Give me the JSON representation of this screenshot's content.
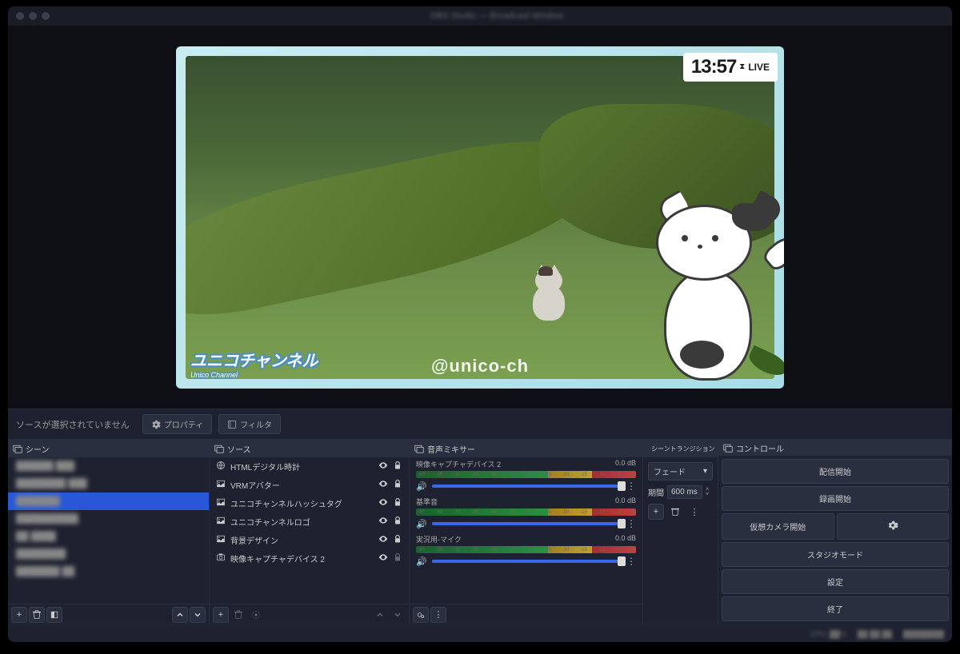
{
  "titlebar": {
    "title": "OBS Studio — Broadcast Window"
  },
  "preview": {
    "clock": "13:57",
    "live": "LIVE",
    "channel_name": "ユニコチャンネル",
    "channel_sub": "Unico Channel",
    "handle": "@unico-ch"
  },
  "toolbar": {
    "no_selection": "ソースが選択されていません",
    "properties": "プロパティ",
    "filters": "フィルタ"
  },
  "panels": {
    "scenes": {
      "title": "シーン"
    },
    "sources": {
      "title": "ソース"
    },
    "mixer": {
      "title": "音声ミキサー"
    },
    "transitions": {
      "title": "シーントランジション"
    },
    "controls": {
      "title": "コントロール"
    }
  },
  "scenes": [
    {
      "label": "██████   ███",
      "selected": false,
      "blur": true
    },
    {
      "label": "████████   ███",
      "selected": false,
      "blur": true
    },
    {
      "label": "███████",
      "selected": true,
      "blur": true
    },
    {
      "label": "██████████",
      "selected": false,
      "blur": true
    },
    {
      "label": "██ ████",
      "selected": false,
      "blur": true
    },
    {
      "label": "████████",
      "selected": false,
      "blur": true
    },
    {
      "label": "███████   ██",
      "selected": false,
      "blur": true
    }
  ],
  "sources": [
    {
      "icon": "globe",
      "label": "HTMLデジタル時計",
      "locked": true
    },
    {
      "icon": "image",
      "label": "VRMアバター",
      "locked": true
    },
    {
      "icon": "image",
      "label": "ユニコチャンネルハッシュタグ",
      "locked": true
    },
    {
      "icon": "image",
      "label": "ユニコチャンネルロゴ",
      "locked": true
    },
    {
      "icon": "image",
      "label": "背景デザイン",
      "locked": true
    },
    {
      "icon": "camera",
      "label": "映像キャプチャデバイス 2",
      "locked": false
    }
  ],
  "mixer": [
    {
      "name": "映像キャプチャデバイス 2",
      "db": "0.0 dB",
      "vol": 100
    },
    {
      "name": "基準音",
      "db": "0.0 dB",
      "vol": 100
    },
    {
      "name": "実況用-マイク",
      "db": "0.0 dB",
      "vol": 100
    }
  ],
  "meter_ticks": [
    "-60",
    "-55",
    "-50",
    "-45",
    "-40",
    "-35",
    "-30",
    "-25",
    "-20",
    "-15",
    "-10",
    "-5",
    "0"
  ],
  "transitions": {
    "type": "フェード",
    "duration_label": "期間",
    "duration": "600 ms"
  },
  "controls": {
    "stream": "配信開始",
    "record": "録画開始",
    "vcam": "仮想カメラ開始",
    "studio": "スタジオモード",
    "settings": "設定",
    "exit": "終了"
  },
  "status": [
    "CPU: ██%",
    "██:██:██",
    "████████"
  ]
}
